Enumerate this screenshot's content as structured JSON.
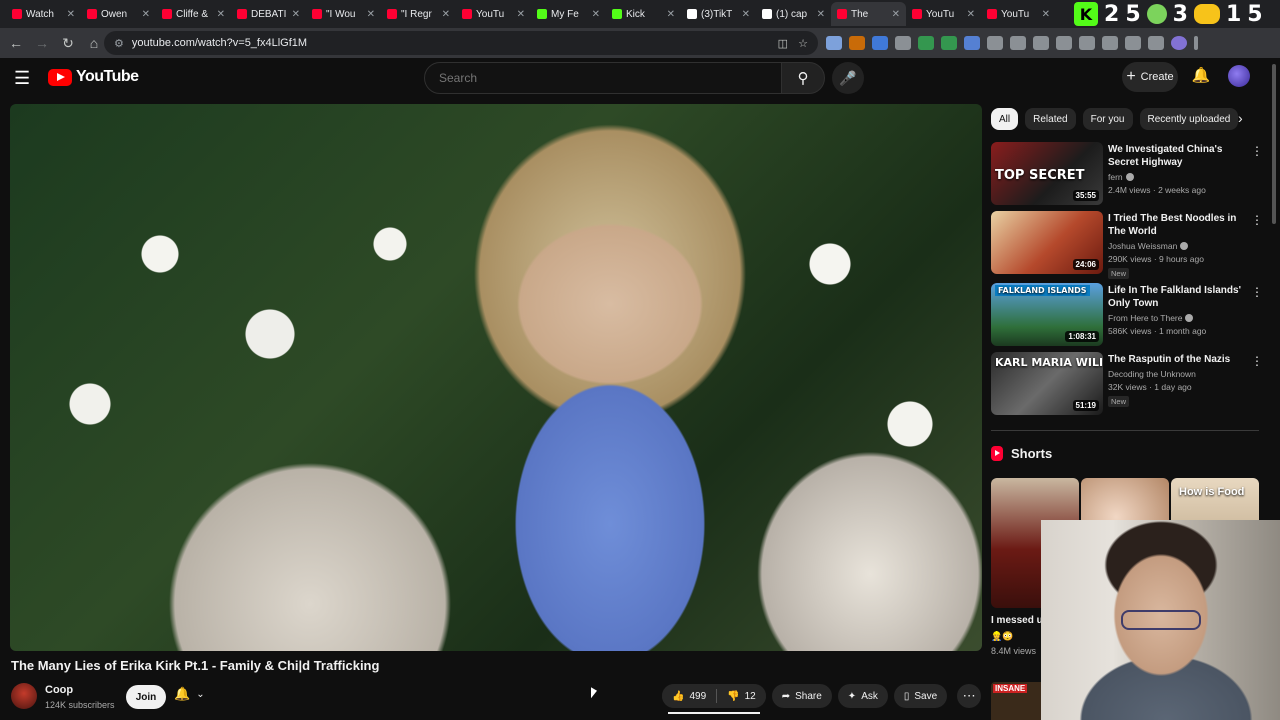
{
  "browser": {
    "tabs": [
      {
        "label": "Watch",
        "color": "#ff0033"
      },
      {
        "label": "Owen",
        "color": "#ff0033"
      },
      {
        "label": "Cliffe &",
        "color": "#ff0033"
      },
      {
        "label": "DEBATI",
        "color": "#ff0033"
      },
      {
        "label": "\"I Wou",
        "color": "#ff0033"
      },
      {
        "label": "\"I Regr",
        "color": "#ff0033"
      },
      {
        "label": "YouTu",
        "color": "#ff0033"
      },
      {
        "label": "My Fe",
        "color": "#53fc18"
      },
      {
        "label": "Kick",
        "color": "#53fc18"
      },
      {
        "label": "(3)TikT",
        "color": "#ffffff"
      },
      {
        "label": "(1) cap",
        "color": "#ffffff"
      },
      {
        "label": "The",
        "color": "#ff0033"
      },
      {
        "label": "YouTu",
        "color": "#ff0033"
      },
      {
        "label": "YouTu",
        "color": "#ff0033"
      }
    ],
    "counter": {
      "a": "2",
      "b": "5",
      "c": "3",
      "d": "1",
      "e": "5"
    },
    "url": "youtube.com/watch?v=5_fx4LlGf1M"
  },
  "masthead": {
    "logo_text": "YouTube",
    "search_placeholder": "Search",
    "create_label": "Create"
  },
  "video": {
    "title": "The Many Lies of Erika Kirk Pt.1 - Family & Chi|d Trafficking",
    "channel": "Coop",
    "subscribers": "124K subscribers",
    "join_label": "Join",
    "likes": "499",
    "dislikes": "12",
    "share_label": "Share",
    "ask_label": "Ask",
    "save_label": "Save"
  },
  "chips": [
    "All",
    "Related",
    "For you",
    "Recently uploaded"
  ],
  "recommendations": [
    {
      "title": "We Investigated China's Secret Highway",
      "channel": "fern",
      "meta": "2.4M views · 2 weeks ago",
      "duration": "35:55",
      "thumb_text": "TOP SECRET",
      "new": ""
    },
    {
      "title": "I Tried The Best Noodles in The World",
      "channel": "Joshua Weissman",
      "meta": "290K views · 9 hours ago",
      "duration": "24:06",
      "thumb_text": "",
      "new": "New"
    },
    {
      "title": "Life In The Falkland Islands' Only Town",
      "channel": "From Here to There",
      "meta": "586K views · 1 month ago",
      "duration": "1:08:31",
      "thumb_text": "FALKLAND ISLANDS",
      "new": ""
    },
    {
      "title": "The Rasputin of the Nazis",
      "channel": "Decoding the Unknown",
      "meta": "32K views · 1 day ago",
      "duration": "51:19",
      "thumb_text": "KARL MARIA WILIGUT",
      "new": "New"
    }
  ],
  "shorts": {
    "heading": "Shorts",
    "first_caption": "I messed u",
    "first_views": "8.4M views",
    "third_thumb_text": "How is Food",
    "bottom_thumb_text": "INSANE"
  }
}
